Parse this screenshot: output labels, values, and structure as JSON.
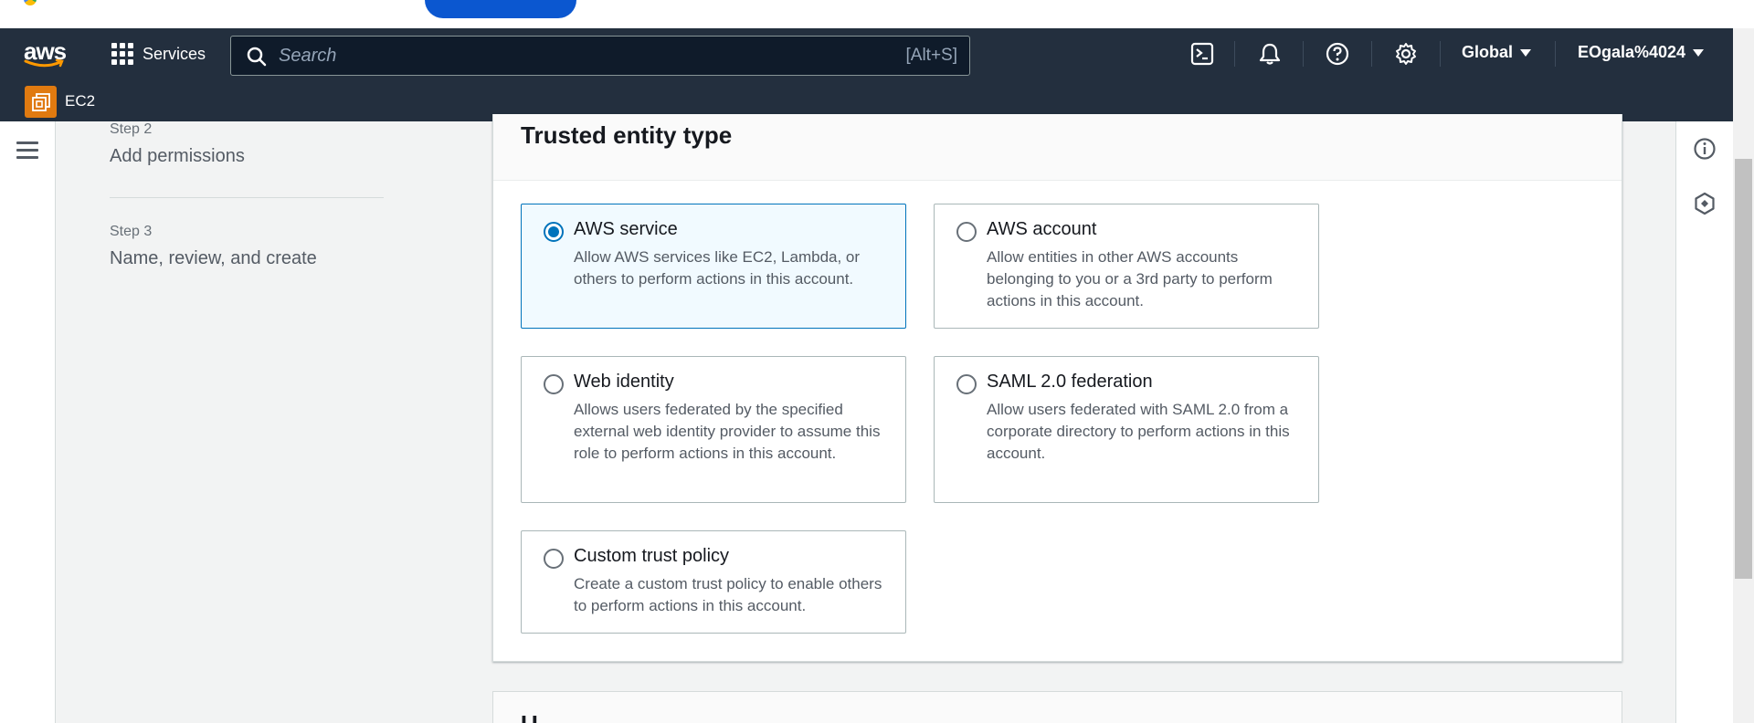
{
  "nav": {
    "logo_text": "aws",
    "services_label": "Services",
    "search_placeholder": "Search",
    "search_shortcut": "[Alt+S]",
    "region_label": "Global",
    "account_label": "EOgala%4024",
    "icons": [
      "cloudshell-icon",
      "bell-icon",
      "help-icon",
      "settings-icon"
    ]
  },
  "service_bar": {
    "service_label": "EC2",
    "service_icon": "ec2-icon"
  },
  "steps": [
    {
      "number": "Step 2",
      "title": "Add permissions"
    },
    {
      "number": "Step 3",
      "title": "Name, review, and create"
    }
  ],
  "trusted_entity": {
    "title": "Trusted entity type",
    "options": [
      {
        "title": "AWS service",
        "desc": "Allow AWS services like EC2, Lambda, or others to perform actions in this account.",
        "selected": true
      },
      {
        "title": "AWS account",
        "desc": "Allow entities in other AWS accounts belonging to you or a 3rd party to perform actions in this account.",
        "selected": false
      },
      {
        "title": "Web identity",
        "desc": "Allows users federated by the specified external web identity provider to assume this role to perform actions in this account.",
        "selected": false
      },
      {
        "title": "SAML 2.0 federation",
        "desc": "Allow users federated with SAML 2.0 from a corporate directory to perform actions in this account.",
        "selected": false
      },
      {
        "title": "Custom trust policy",
        "desc": "Create a custom trust policy to enable others to perform actions in this account.",
        "selected": false
      }
    ]
  },
  "next_section_peek": "U",
  "colors": {
    "nav_bg": "#232f3e",
    "accent_blue": "#0073bb",
    "selected_tile_bg": "#f1faff",
    "ec2_orange": "#e07a10"
  }
}
